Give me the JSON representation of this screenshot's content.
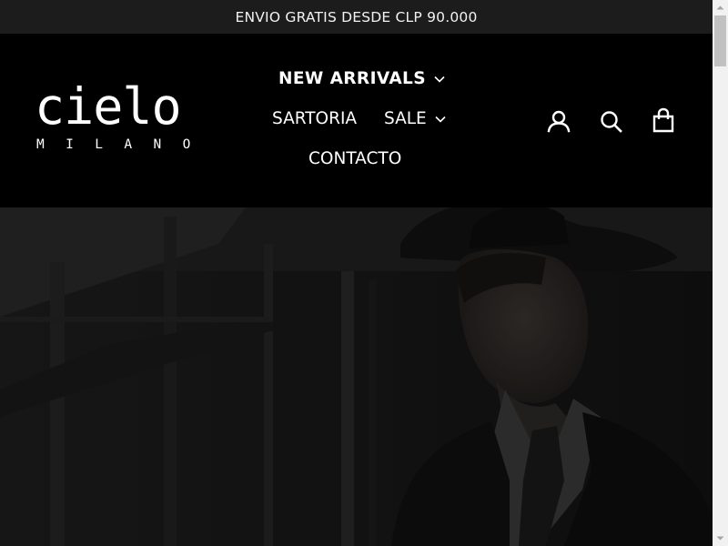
{
  "announcement": {
    "text": "ENVIO GRATIS DESDE CLP 90.000"
  },
  "brand": {
    "name": "cielo",
    "subtitle": "MILANO"
  },
  "nav": {
    "new_arrivals": "NEW ARRIVALS",
    "sartoria": "SARTORIA",
    "sale": "SALE",
    "contacto": "CONTACTO"
  },
  "icons": {
    "account": "account-icon",
    "search": "search-icon",
    "cart": "cart-icon",
    "dropdown": "chevron-down-icon"
  },
  "colors": {
    "announcement_bg": "#1c1c1c",
    "header_bg": "#000000",
    "text": "#ffffff"
  }
}
